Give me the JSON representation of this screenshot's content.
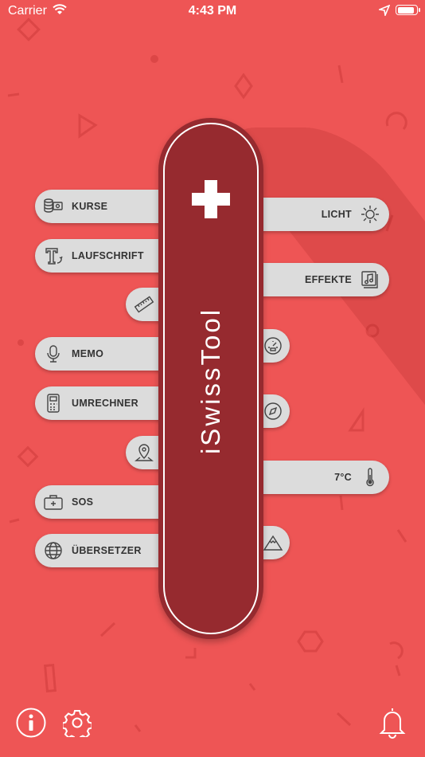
{
  "status_bar": {
    "carrier": "Carrier",
    "time": "4:43 PM"
  },
  "app": {
    "logo_text": "iSwissTool"
  },
  "left_tools": [
    {
      "label": "KURSE",
      "icon": "coins-icon"
    },
    {
      "label": "LAUFSCHRIFT",
      "icon": "scrolling-text-icon"
    },
    {
      "label": "",
      "icon": "ruler-icon"
    },
    {
      "label": "MEMO",
      "icon": "microphone-icon"
    },
    {
      "label": "UMRECHNER",
      "icon": "calculator-icon"
    },
    {
      "label": "",
      "icon": "map-pin-icon"
    },
    {
      "label": "SOS",
      "icon": "first-aid-icon"
    },
    {
      "label": "ÜBERSETZER",
      "icon": "globe-icon"
    }
  ],
  "right_tools": [
    {
      "label": "LICHT",
      "icon": "sun-icon"
    },
    {
      "label": "EFFEKTE",
      "icon": "music-icon"
    },
    {
      "label": "",
      "icon": "speedometer-icon"
    },
    {
      "label": "",
      "icon": "compass-icon"
    },
    {
      "label": "7°C",
      "icon": "thermometer-icon"
    },
    {
      "label": "",
      "icon": "mountain-icon"
    }
  ],
  "colors": {
    "background": "#ee5555",
    "knife": "#962a2f",
    "tool": "#dcdcdc"
  }
}
